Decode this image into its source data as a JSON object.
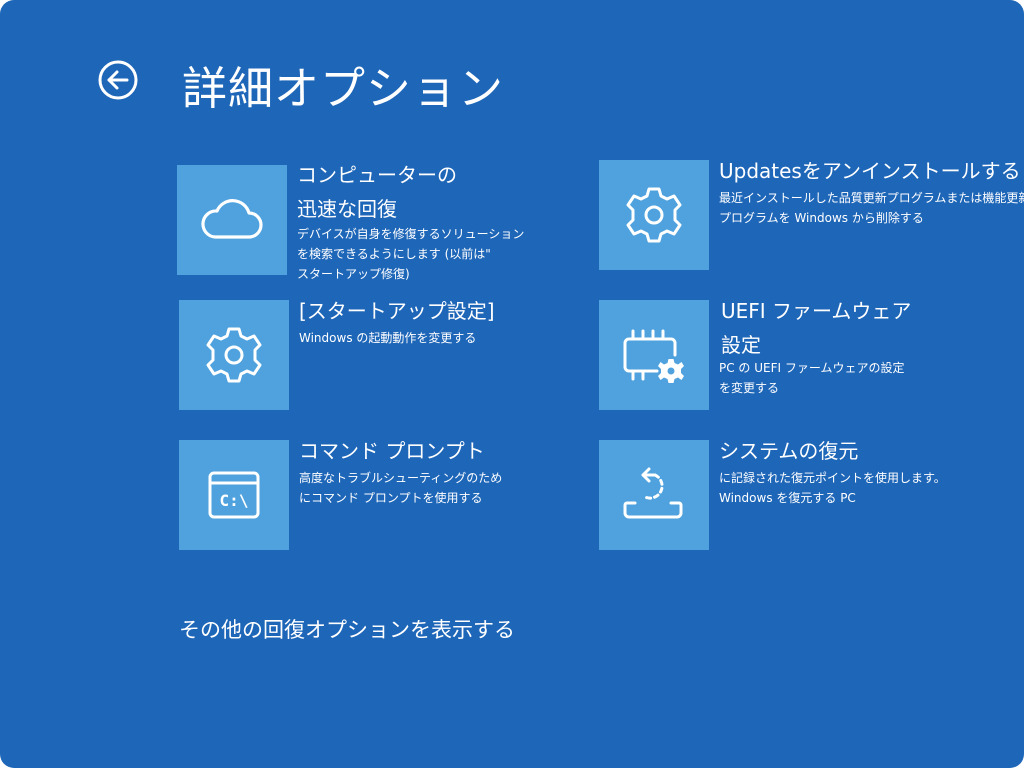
{
  "page": {
    "title": "詳細オプション",
    "back_icon": "back-arrow-circle-icon"
  },
  "options": [
    {
      "id": "startup-repair",
      "icon": "cloud-icon",
      "title_lines": [
        "コンピューターの",
        "迅速な回復"
      ],
      "desc_lines": [
        "デバイスが自身を修復するソリューション",
        "を検索できるようにします (以前は\"",
        "スタートアップ修復)"
      ]
    },
    {
      "id": "uninstall-updates",
      "icon": "gear-icon",
      "title_lines": [
        "Updatesをアンインストールする"
      ],
      "desc_lines": [
        "最近インストールした品質更新プログラムまたは機能更新",
        "プログラムを Windows から削除する"
      ]
    },
    {
      "id": "startup-settings",
      "icon": "gear-icon",
      "title_lines": [
        "[スタートアップ設定]"
      ],
      "desc_lines": [
        "Windows の起動動作を変更する"
      ]
    },
    {
      "id": "uefi-firmware",
      "icon": "chip-gear-icon",
      "title_lines": [
        "UEFI ファームウェア",
        "設定"
      ],
      "desc_lines": [
        "PC の UEFI ファームウェアの設定",
        "を変更する"
      ]
    },
    {
      "id": "command-prompt",
      "icon": "command-prompt-icon",
      "icon_text": "C:\\",
      "title_lines": [
        "コマンド プロンプト"
      ],
      "desc_lines": [
        "高度なトラブルシューティングのため",
        "にコマンド プロンプトを使用する"
      ]
    },
    {
      "id": "system-restore",
      "icon": "system-restore-icon",
      "title_lines": [
        "システムの復元"
      ],
      "desc_lines": [
        "に記録された復元ポイントを使用します。",
        "Windows を復元する PC"
      ]
    }
  ],
  "more_options_link": "その他の回復オプションを表示する",
  "colors": {
    "background": "#1e66b8",
    "tile": "#4fa2de",
    "text": "#ffffff"
  }
}
